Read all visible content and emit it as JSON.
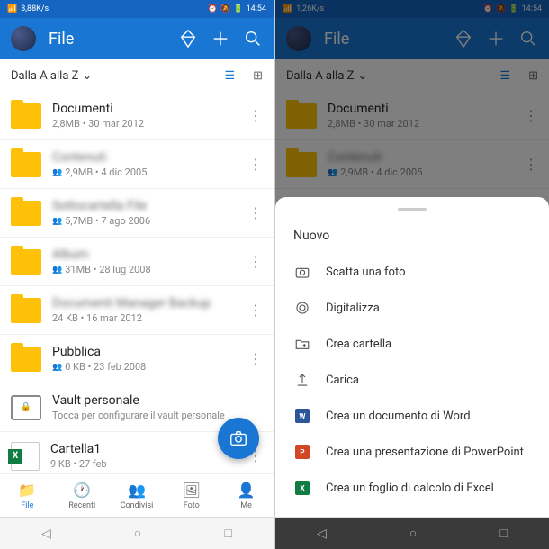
{
  "status": {
    "speed_left": "3,88K/s",
    "speed_right": "1,26K/s",
    "time": "14:54"
  },
  "header": {
    "title": "File"
  },
  "sort": {
    "label": "Dalla A alla Z"
  },
  "files": [
    {
      "name": "Documenti",
      "sub": "2,8MB • 30 mar 2012",
      "blur": false
    },
    {
      "name": "Contenuti",
      "sub": "2,9MB • 4 dic 2005",
      "blur": true,
      "shared": true
    },
    {
      "name": "Sottocartella File",
      "sub": "5,7MB • 7 ago 2006",
      "blur": true,
      "shared": true
    },
    {
      "name": "Album",
      "sub": "31MB • 28 lug 2008",
      "blur": true,
      "shared": true
    },
    {
      "name": "Documenti Manager Backup",
      "sub": "24 KB • 16 mar 2012",
      "blur": true
    },
    {
      "name": "Pubblica",
      "sub": "0 KB • 23 feb 2008",
      "blur": false,
      "shared": true
    }
  ],
  "vault": {
    "name": "Vault personale",
    "sub": "Tocca per configurare il vault personale"
  },
  "file1": {
    "name": "Cartella1",
    "sub": "9 KB • 27 feb"
  },
  "nav": {
    "file": "File",
    "recenti": "Recenti",
    "condivisi": "Condivisi",
    "foto": "Foto",
    "me": "Me"
  },
  "sheet": {
    "title": "Nuovo",
    "items": {
      "photo": "Scatta una foto",
      "scan": "Digitalizza",
      "folder": "Crea cartella",
      "upload": "Carica",
      "word": "Crea un documento di Word",
      "ppt": "Crea una presentazione di PowerPoint",
      "excel": "Crea un foglio di calcolo di Excel"
    }
  }
}
